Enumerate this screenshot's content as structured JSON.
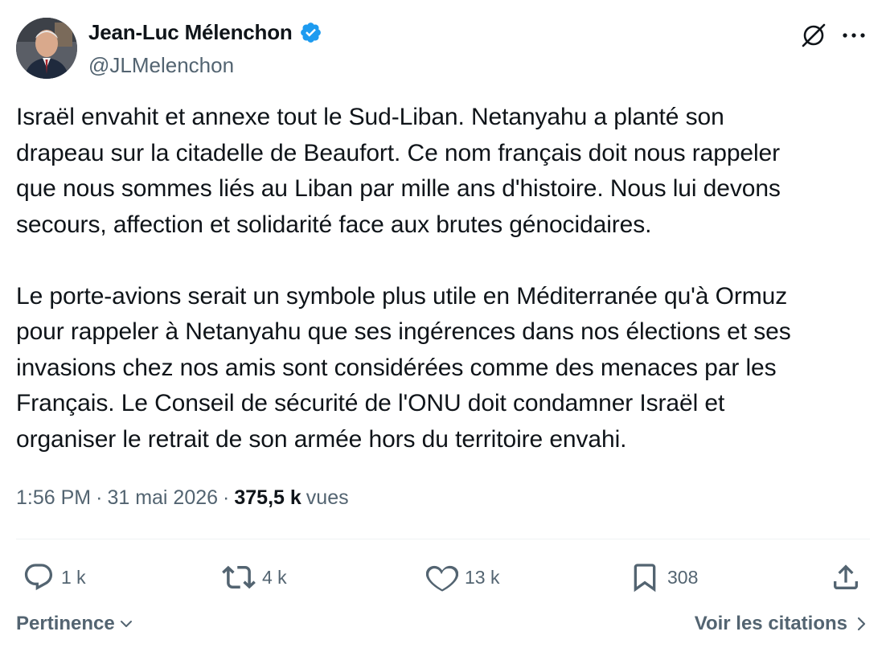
{
  "author": {
    "display_name": "Jean-Luc Mélenchon",
    "handle": "@JLMelenchon",
    "verified": true
  },
  "post": {
    "text": "Israël envahit et annexe tout le Sud-Liban. Netanyahu a planté son\ndrapeau sur la citadelle de Beaufort. Ce nom français doit nous rappeler\nque nous sommes liés au Liban par mille ans d'histoire. Nous lui devons\nsecours, affection et solidarité face aux brutes génocidaires.\n\nLe porte-avions serait un symbole plus utile en Méditerranée qu'à Ormuz\npour rappeler à Netanyahu que ses ingérences dans nos élections et ses\ninvasions chez nos amis sont considérées comme des menaces par les\nFrançais. Le Conseil de sécurité de l'ONU doit condamner Israël et\norganiser le retrait de son armée hors du territoire envahi.",
    "time": "1:56 PM",
    "separator": "·",
    "date": "31 mai 2026",
    "views_count": "375,5 k",
    "views_label": "vues"
  },
  "actions": {
    "replies": "1 k",
    "reposts": "4 k",
    "likes": "13 k",
    "bookmarks": "308"
  },
  "footer": {
    "sort_label": "Pertinence",
    "quotes_label": "Voir les citations"
  },
  "icons": {
    "verified": "verified-badge-icon",
    "grok": "grok-icon",
    "more": "more-icon",
    "reply": "reply-icon",
    "repost": "repost-icon",
    "like": "heart-icon",
    "bookmark": "bookmark-icon",
    "share": "share-icon"
  },
  "colors": {
    "text": "#0f1419",
    "secondary": "#536471",
    "verified": "#1d9bf0",
    "divider": "#eff3f4"
  }
}
